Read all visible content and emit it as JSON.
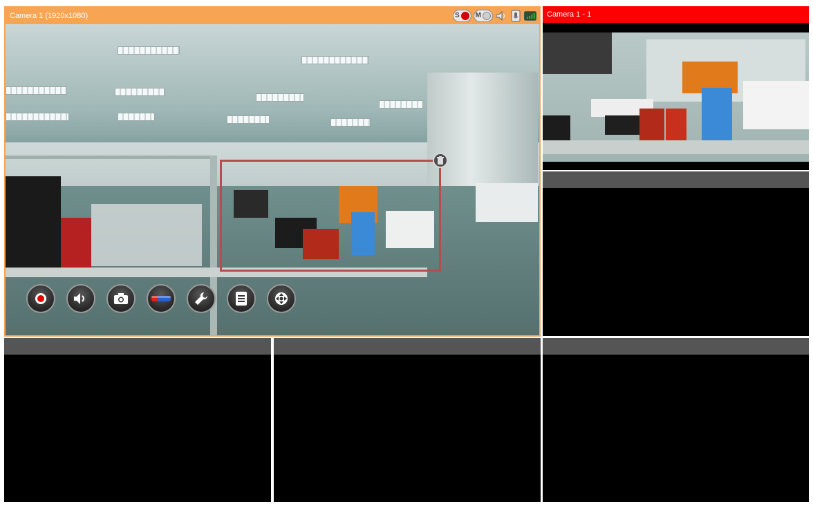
{
  "main_pane": {
    "title": "Camera 1 (1920x1080)",
    "status_icons": [
      "record-status-icon",
      "motion-status-icon",
      "speaker-icon",
      "microphone-icon",
      "signal-strength-icon"
    ],
    "status_letters": {
      "record": "S",
      "motion": "M"
    },
    "toolbar": [
      "record-icon",
      "audio-icon",
      "snapshot-icon",
      "digital-zoom-icon",
      "settings-wrench-icon",
      "info-list-icon",
      "ptz-icon"
    ]
  },
  "top_right_pane": {
    "title": "Camera 1 - 1"
  },
  "colors": {
    "main_header": "#f7a453",
    "active_header": "#ff0000",
    "empty_header": "#555555",
    "pane_background": "#000000",
    "roi_border": "#b54d4d"
  }
}
